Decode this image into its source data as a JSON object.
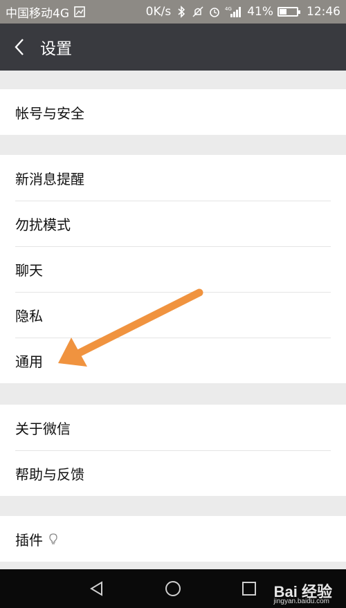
{
  "status_bar": {
    "carrier": "中国移动4G",
    "speed": "0K/s",
    "network": "4G",
    "battery_percent": "41%",
    "battery_level": 0.41,
    "time": "12:46"
  },
  "header": {
    "title": "设置"
  },
  "groups": [
    {
      "items": [
        {
          "label": "帐号与安全"
        }
      ]
    },
    {
      "items": [
        {
          "label": "新消息提醒"
        },
        {
          "label": "勿扰模式"
        },
        {
          "label": "聊天"
        },
        {
          "label": "隐私"
        },
        {
          "label": "通用"
        }
      ]
    },
    {
      "items": [
        {
          "label": "关于微信"
        },
        {
          "label": "帮助与反馈"
        }
      ]
    },
    {
      "items": [
        {
          "label": "插件"
        }
      ]
    }
  ],
  "watermark": {
    "text": "Bai 经验",
    "url": "jingyan.baidu.com"
  },
  "colors": {
    "status_bar": "#8d8a85",
    "title_bar": "#393a3f",
    "background": "#ebebeb",
    "arrow": "#f0933f"
  }
}
